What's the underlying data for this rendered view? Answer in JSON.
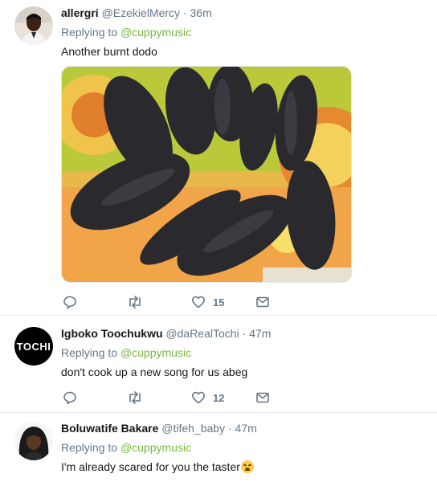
{
  "tweets": [
    {
      "name": "allergri",
      "handle": "@EzekielMercy",
      "separator": "·",
      "time": "36m",
      "replying_prefix": "Replying to",
      "replying_to": "@cuppymusic",
      "text": "Another burnt dodo",
      "likes": "15",
      "has_image": true
    },
    {
      "name": "Igboko Toochukwu",
      "handle": "@daRealTochi",
      "separator": "·",
      "time": "47m",
      "replying_prefix": "Replying to",
      "replying_to": "@cuppymusic",
      "text": "don't cook up a new song for us abeg",
      "likes": "12",
      "avatar_text": "TOCHI"
    },
    {
      "name": "Boluwatife Bakare",
      "handle": "@tifeh_baby",
      "separator": "·",
      "time": "47m",
      "replying_prefix": "Replying to",
      "replying_to": "@cuppymusic",
      "text": "I'm already scared for you the taster",
      "emoji": "loudly-crying-face"
    }
  ],
  "icons": {
    "reply": "reply-icon",
    "retweet": "retweet-icon",
    "like": "heart-icon",
    "dm": "envelope-icon"
  },
  "colors": {
    "mention": "#79b83f",
    "secondary": "#657786",
    "divider": "#e6ecf0"
  }
}
